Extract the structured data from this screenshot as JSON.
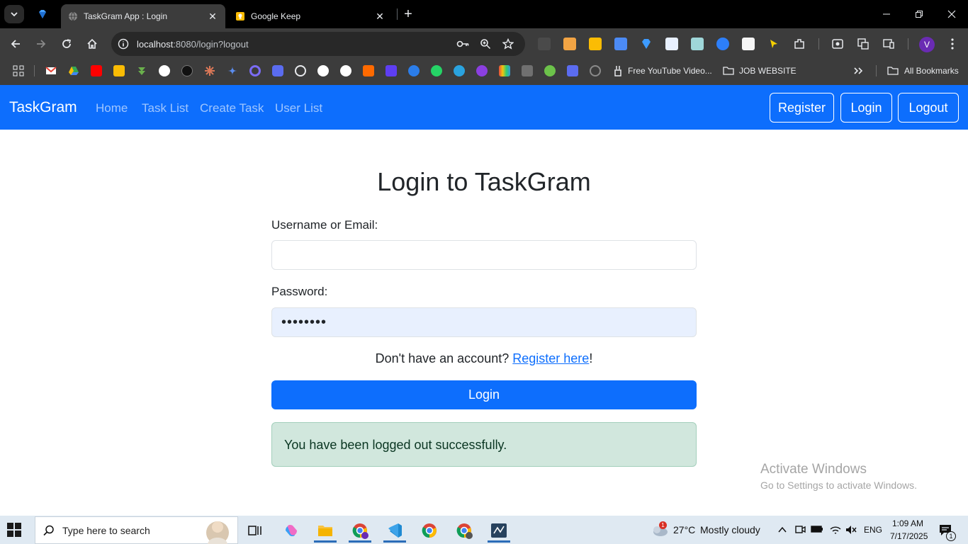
{
  "browser": {
    "tabs": [
      {
        "title": "TaskGram App : Login",
        "active": true
      },
      {
        "title": "Google Keep",
        "active": false
      }
    ],
    "url_host": "localhost",
    "url_path": ":8080/login?logout",
    "profile_initial": "V",
    "bookmarks": {
      "youtube_video": "Free YouTube Video...",
      "job_folder": "JOB WEBSITE",
      "all_bookmarks": "All Bookmarks"
    }
  },
  "app": {
    "brand": "TaskGram",
    "nav_links": [
      "Home",
      "Task List",
      "Create Task",
      "User List"
    ],
    "nav_buttons": [
      "Register",
      "Login",
      "Logout"
    ],
    "login": {
      "title": "Login to TaskGram",
      "username_label": "Username or Email:",
      "username_value": "",
      "password_label": "Password:",
      "password_value": "••••••••",
      "register_prompt": "Don't have an account?",
      "register_link": "Register here",
      "register_suffix": "!",
      "submit_label": "Login",
      "alert_message": "You have been logged out successfully."
    }
  },
  "watermark": {
    "line1": "Activate Windows",
    "line2": "Go to Settings to activate Windows."
  },
  "taskbar": {
    "search_placeholder": "Type here to search",
    "weather_temp": "27°C",
    "weather_desc": "Mostly cloudy",
    "weather_badge": "1",
    "language": "ENG",
    "time": "1:09 AM",
    "date": "7/17/2025",
    "notification_count": "1"
  },
  "colors": {
    "primary": "#0d6efd",
    "alert_bg": "#d1e7dd",
    "browser_dark": "#3c3c3c"
  }
}
